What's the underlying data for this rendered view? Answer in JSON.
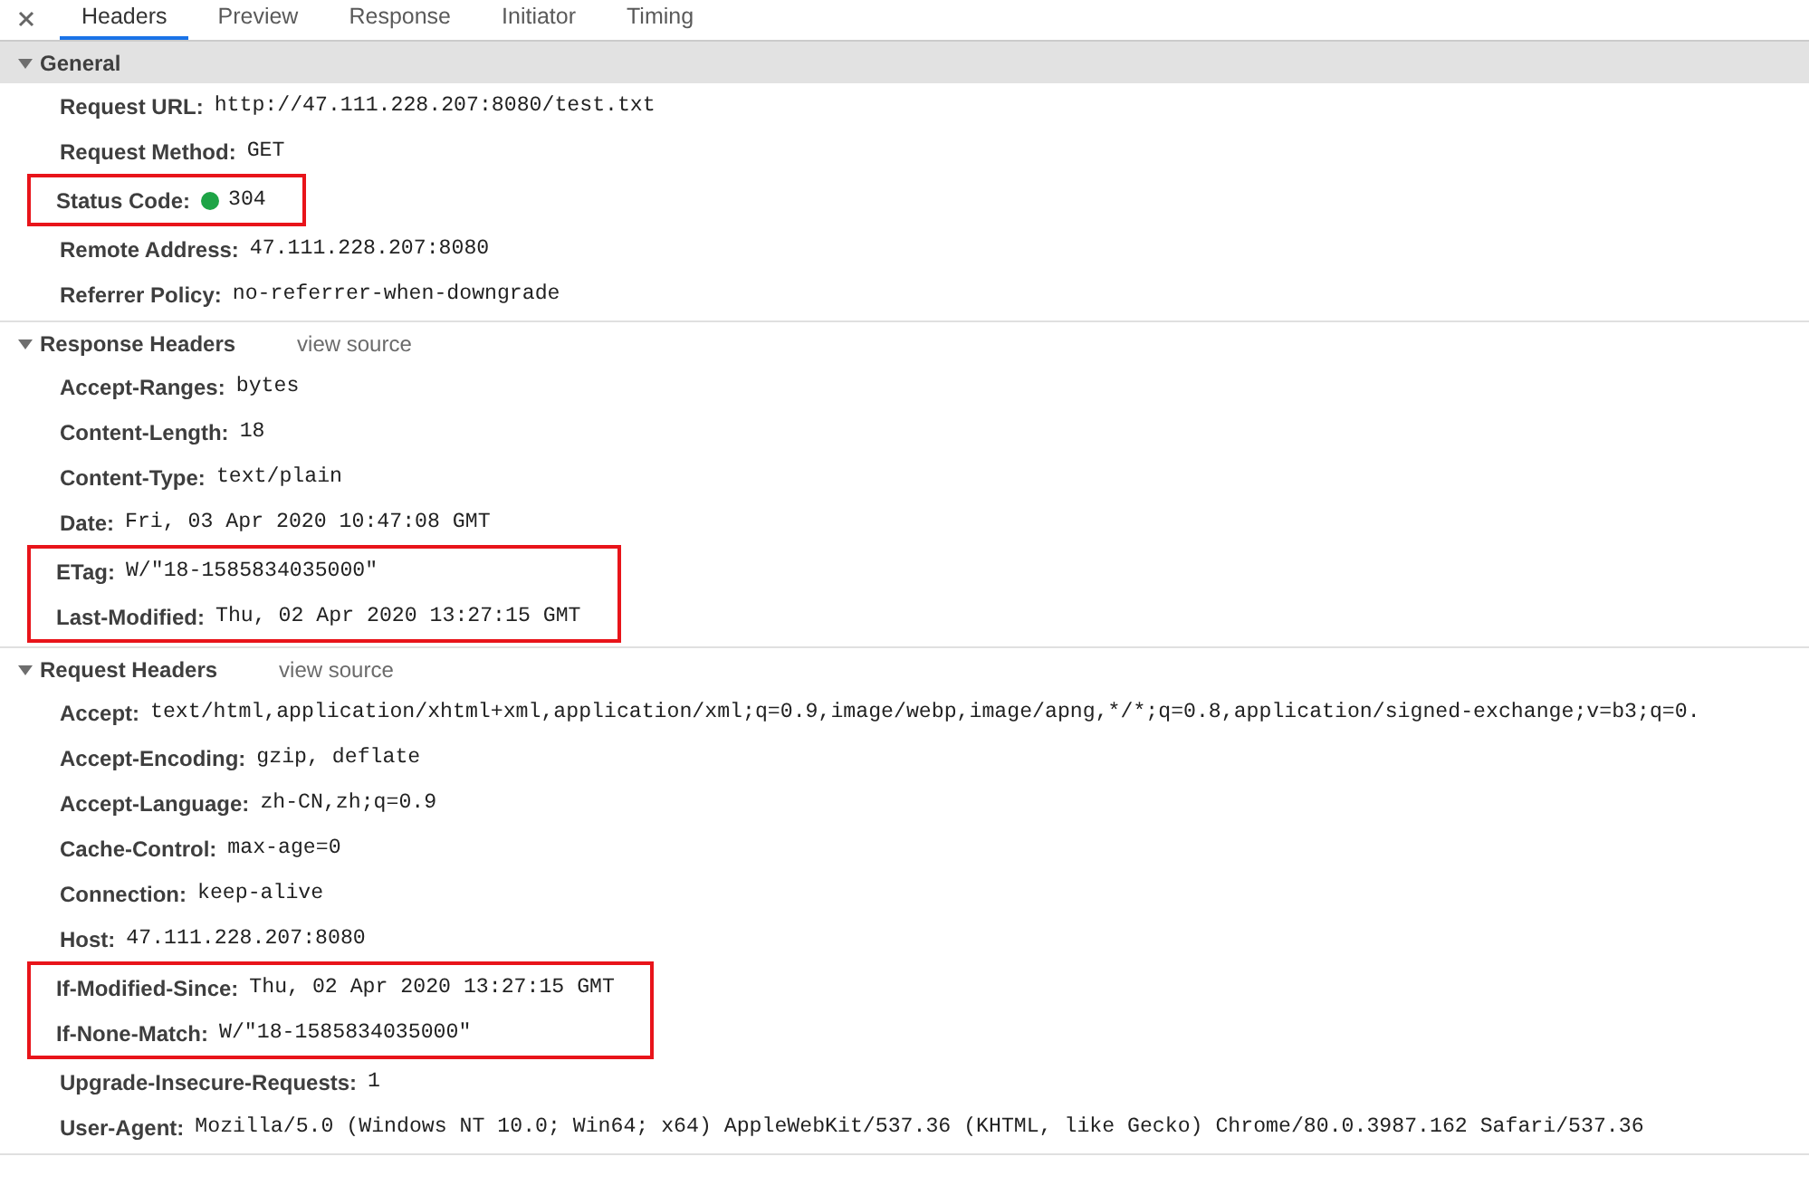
{
  "tabs": [
    {
      "label": "Headers",
      "selected": true
    },
    {
      "label": "Preview",
      "selected": false
    },
    {
      "label": "Response",
      "selected": false
    },
    {
      "label": "Initiator",
      "selected": false
    },
    {
      "label": "Timing",
      "selected": false
    }
  ],
  "sections": [
    {
      "title": "General",
      "expanded": true,
      "shaded": true,
      "rows": [
        {
          "name": "Request URL:",
          "value": "http://47.111.228.207:8080/test.txt",
          "highlighted": false
        },
        {
          "name": "Request Method:",
          "value": "GET",
          "highlighted": false
        },
        {
          "name": "Status Code:",
          "value": "304",
          "highlighted": true,
          "kind": "status",
          "color": "#1ea446"
        },
        {
          "name": "Remote Address:",
          "value": "47.111.228.207:8080",
          "highlighted": false
        },
        {
          "name": "Referrer Policy:",
          "value": "no-referrer-when-downgrade",
          "highlighted": false
        }
      ]
    },
    {
      "title": "Response Headers",
      "link": "view source",
      "expanded": true,
      "shaded": false,
      "rows": [
        {
          "name": "Accept-Ranges:",
          "value": "bytes",
          "highlighted": false
        },
        {
          "name": "Content-Length:",
          "value": "18",
          "highlighted": false
        },
        {
          "name": "Content-Type:",
          "value": "text/plain",
          "highlighted": false
        },
        {
          "name": "Date:",
          "value": "Fri, 03 Apr 2020 10:47:08 GMT",
          "highlighted": false
        },
        {
          "name": "ETag:",
          "value": "W/\"18-1585834035000\"",
          "highlighted": true
        },
        {
          "name": "Last-Modified:",
          "value": "Thu, 02 Apr 2020 13:27:15 GMT",
          "highlighted": true
        }
      ]
    },
    {
      "title": "Request Headers",
      "link": "view source",
      "expanded": true,
      "shaded": false,
      "rows": [
        {
          "name": "Accept:",
          "value": "text/html,application/xhtml+xml,application/xml;q=0.9,image/webp,image/apng,*/*;q=0.8,application/signed-exchange;v=b3;q=0.",
          "highlighted": false
        },
        {
          "name": "Accept-Encoding:",
          "value": "gzip, deflate",
          "highlighted": false
        },
        {
          "name": "Accept-Language:",
          "value": "zh-CN,zh;q=0.9",
          "highlighted": false
        },
        {
          "name": "Cache-Control:",
          "value": "max-age=0",
          "highlighted": false
        },
        {
          "name": "Connection:",
          "value": "keep-alive",
          "highlighted": false
        },
        {
          "name": "Host:",
          "value": "47.111.228.207:8080",
          "highlighted": false
        },
        {
          "name": "If-Modified-Since:",
          "value": "Thu, 02 Apr 2020 13:27:15 GMT",
          "highlighted": true
        },
        {
          "name": "If-None-Match:",
          "value": "W/\"18-1585834035000\"",
          "highlighted": true
        },
        {
          "name": "Upgrade-Insecure-Requests:",
          "value": "1",
          "highlighted": false
        },
        {
          "name": "User-Agent:",
          "value": "Mozilla/5.0 (Windows NT 10.0; Win64; x64) AppleWebKit/537.36 (KHTML, like Gecko) Chrome/80.0.3987.162 Safari/537.36",
          "highlighted": false
        }
      ]
    }
  ]
}
